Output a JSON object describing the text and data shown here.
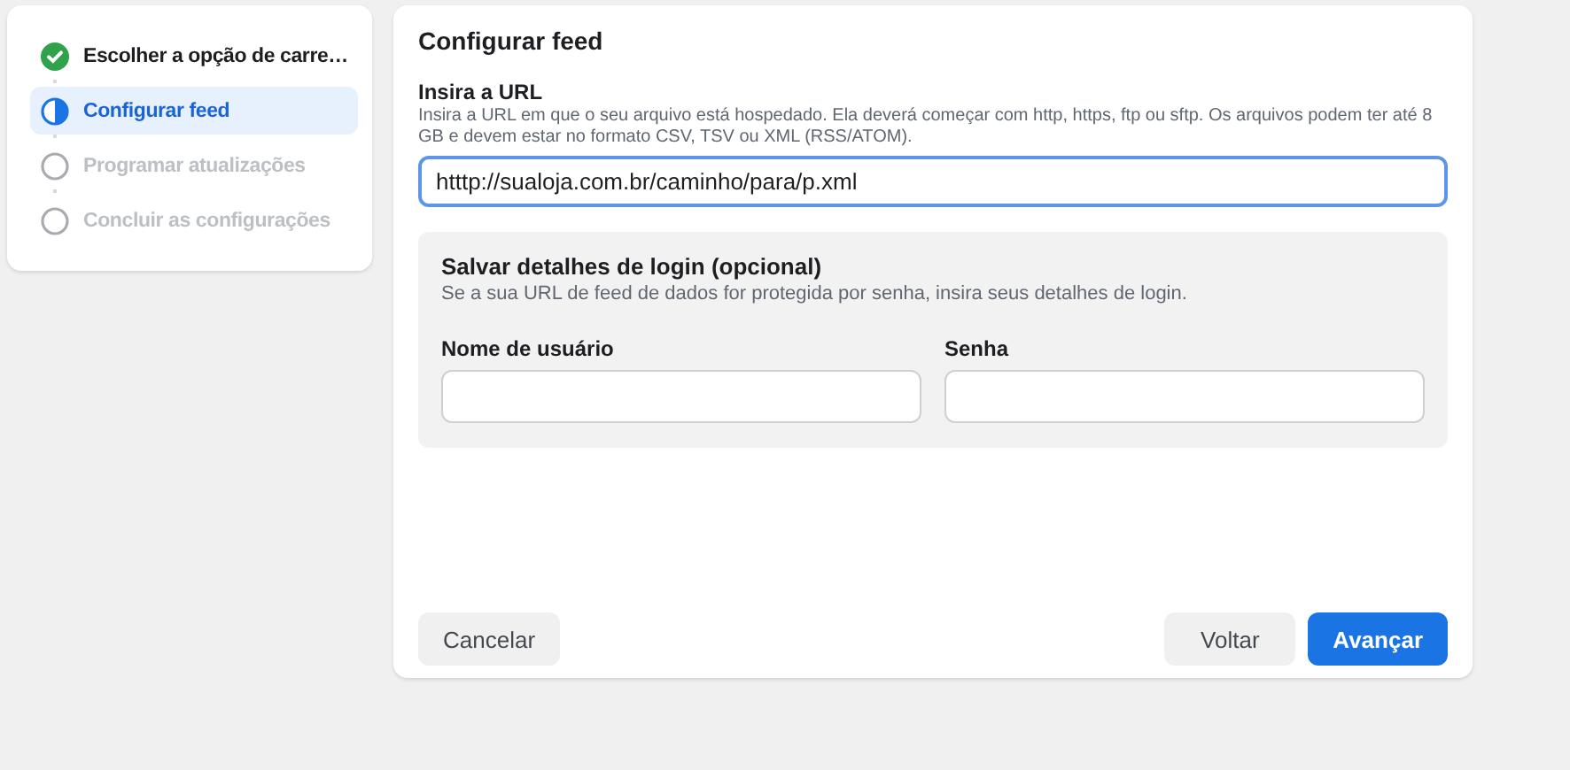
{
  "steps": [
    {
      "label": "Escolher a opção de carre…",
      "kind": "done",
      "selected": false
    },
    {
      "label": "Configurar feed",
      "kind": "current",
      "selected": true
    },
    {
      "label": "Programar atualizações",
      "kind": "pending",
      "selected": false
    },
    {
      "label": "Concluir as configurações",
      "kind": "pending",
      "selected": false
    }
  ],
  "panel": {
    "title": "Configurar feed",
    "url_field": {
      "label": "Insira a URL",
      "help": "Insira a URL em que o seu arquivo está hospedado. Ela deverá começar com http, https, ftp ou sftp. Os arquivos podem ter até 8 GB e devem estar no formato CSV, TSV ou XML (RSS/ATOM).",
      "value": "htttp://sualoja.com.br/caminho/para/p.xml",
      "focused": true
    },
    "login": {
      "title": "Salvar detalhes de login (opcional)",
      "description": "Se a sua URL de feed de dados for protegida por senha, insira seus detalhes de login.",
      "fields": [
        {
          "label": "Nome de usuário"
        },
        {
          "label": "Senha"
        }
      ]
    },
    "buttons": [
      {
        "label": "Cancelar",
        "kind": "secondary"
      },
      {
        "label": "Voltar",
        "kind": "secondary"
      },
      {
        "label": "Avançar",
        "kind": "primary"
      }
    ]
  }
}
